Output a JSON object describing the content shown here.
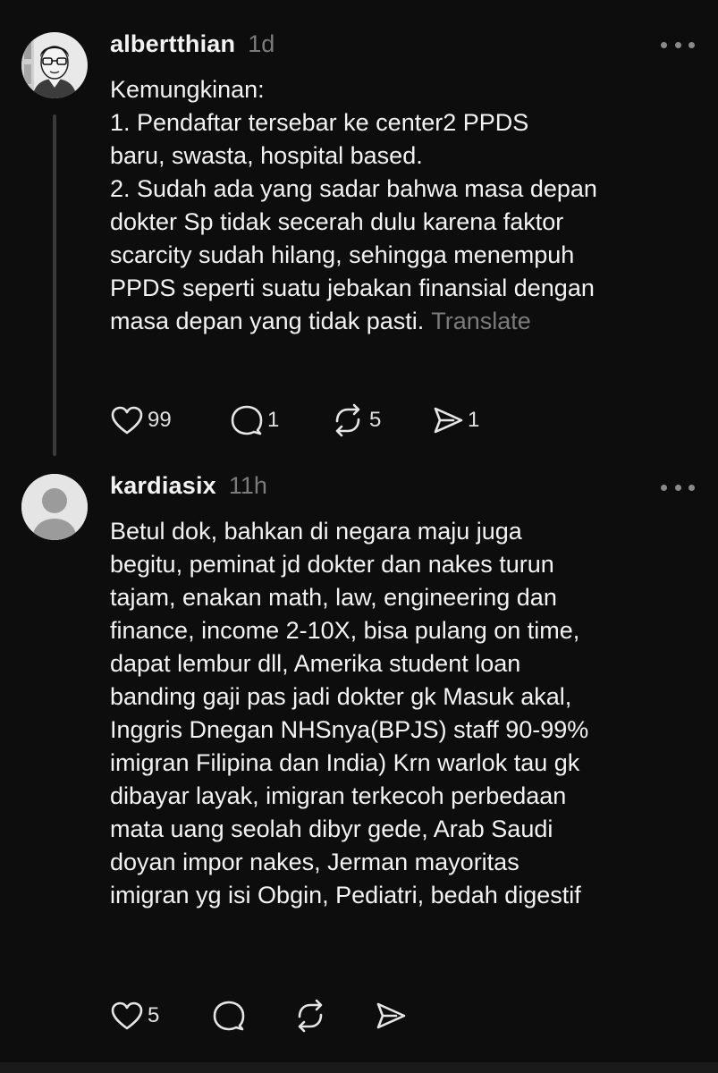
{
  "posts": [
    {
      "username": "albertthian",
      "time": "1d",
      "avatar_icon": "cartoon-man-with-glasses-avatar",
      "lines": [
        "Kemungkinan:",
        "1. Pendaftar tersebar ke center2 PPDS",
        "baru, swasta, hospital based.",
        "2. Sudah ada yang sadar bahwa masa depan",
        "dokter Sp tidak secerah dulu karena faktor",
        "scarcity sudah hilang, sehingga menempuh",
        "PPDS seperti suatu jebakan finansial dengan",
        "masa depan yang tidak pasti."
      ],
      "translate_label": "Translate",
      "likes": "99",
      "replies": "1",
      "reposts": "5",
      "shares": "1"
    },
    {
      "username": "kardiasix",
      "time": "11h",
      "avatar_icon": "default-user-avatar",
      "lines": [
        "Betul dok, bahkan di negara maju juga",
        "begitu, peminat jd dokter dan nakes turun",
        "tajam, enakan math, law, engineering dan",
        "finance, income 2-10X, bisa pulang on time,",
        "dapat lembur dll, Amerika student loan",
        "banding gaji pas jadi dokter gk Masuk akal,",
        "Inggris Dnegan NHSnya(BPJS) staff 90-99%",
        "imigran Filipina dan India) Krn warlok tau gk",
        "dibayar layak, imigran terkecoh perbedaan",
        "mata uang seolah dibyr gede, Arab Saudi",
        "doyan impor nakes, Jerman mayoritas",
        "imigran yg isi Obgin, Pediatri, bedah digestif"
      ],
      "likes": "5"
    }
  ],
  "colors": {
    "background": "#0d0d0d",
    "text": "#f3f3f3",
    "muted": "#7b7b7b",
    "thread_line": "#3a3a3a"
  }
}
